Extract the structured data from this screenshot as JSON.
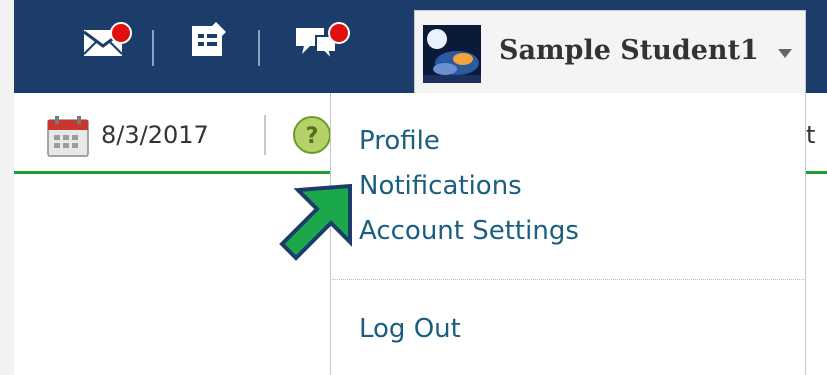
{
  "topbar": {
    "icons": [
      "mail-icon",
      "updates-icon",
      "chat-icon"
    ],
    "notification_badges": {
      "mail": true,
      "chat": true
    }
  },
  "user_menu": {
    "name": "Sample Student1"
  },
  "subbar": {
    "date": "8/3/2017",
    "right_partial_text": "t"
  },
  "dropdown": {
    "items": [
      {
        "label": "Profile"
      },
      {
        "label": "Notifications"
      },
      {
        "label": "Account Settings"
      }
    ],
    "logout_label": "Log Out"
  },
  "colors": {
    "topbar": "#1c3c6a",
    "accent_green": "#19a039",
    "badge_red": "#e00f10",
    "menu_link": "#1b5e7f",
    "arrow_fill": "#1aa84a",
    "arrow_border": "#1c3c6a"
  }
}
